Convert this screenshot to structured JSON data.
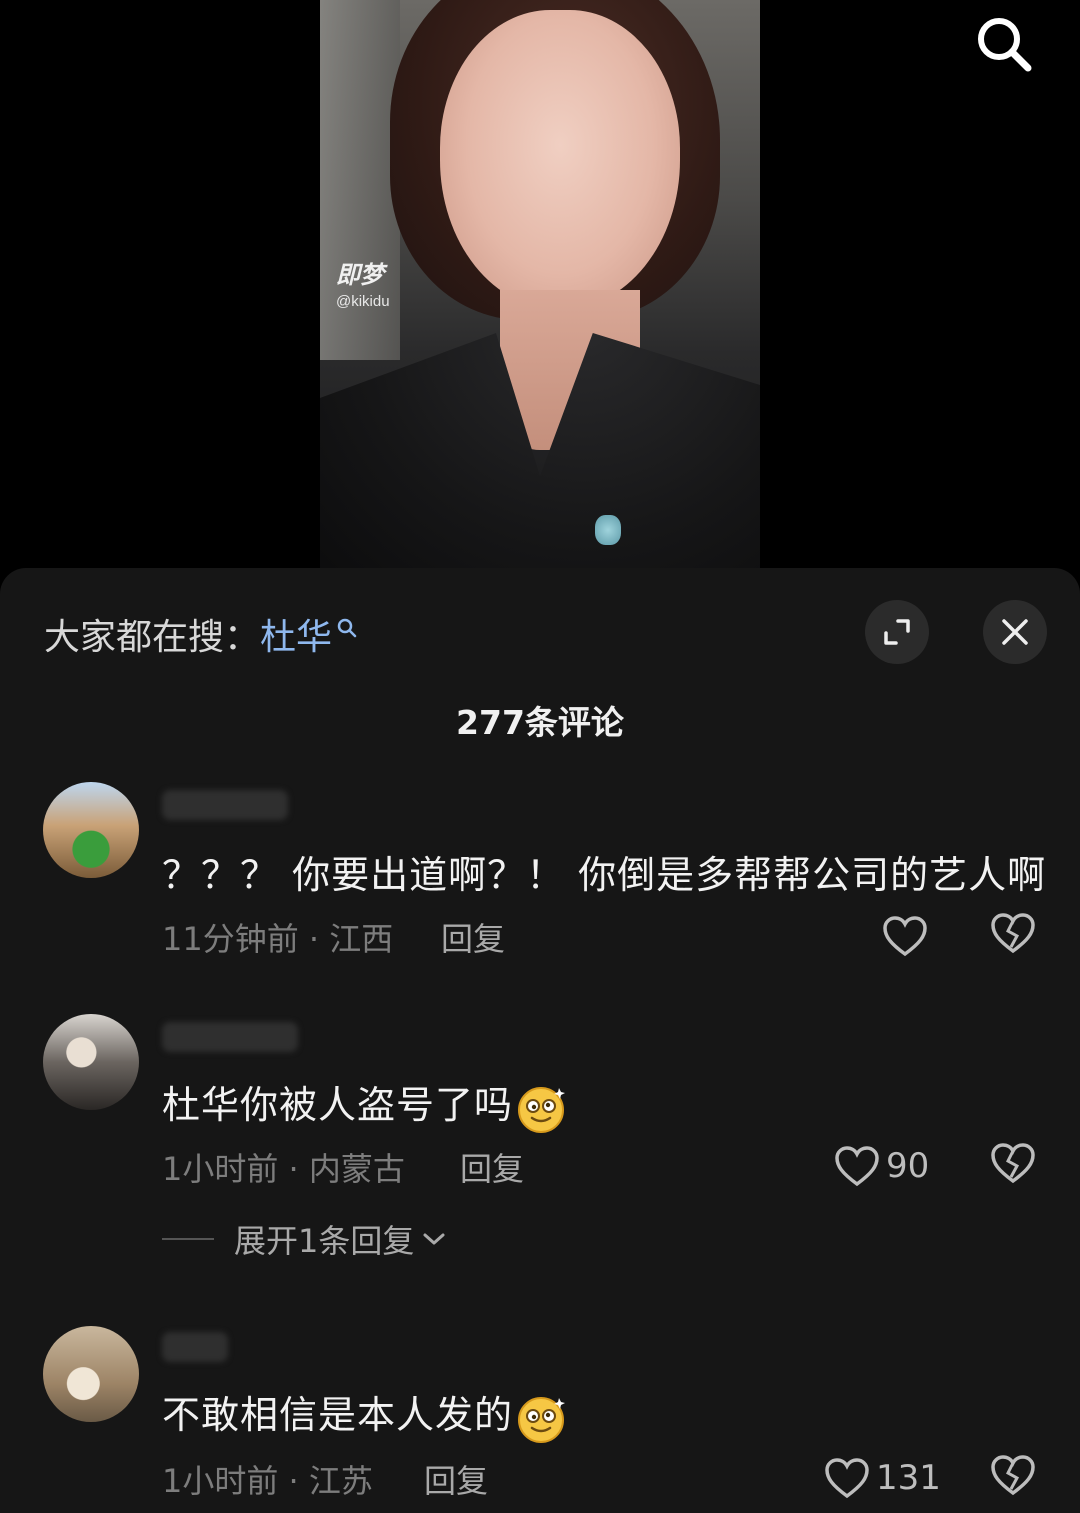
{
  "video": {
    "watermark_logo": "即梦",
    "watermark_handle": "@kikidu"
  },
  "search_icon": "search-icon",
  "sheet": {
    "search_prefix": "大家都在搜：",
    "search_keyword": "杜华",
    "expand_icon": "expand-icon",
    "close_icon": "close-icon",
    "comment_count": "277条评论"
  },
  "comments": [
    {
      "text": "？？？ 你要出道啊？！ 你倒是多帮帮公司的艺人啊",
      "meta": "11分钟前 · 江西",
      "reply_label": "回复",
      "likes": ""
    },
    {
      "text": "杜华你被人盗号了吗",
      "meta": "1小时前 · 内蒙古",
      "reply_label": "回复",
      "likes": "90",
      "expand_label": "展开1条回复"
    },
    {
      "text": "不敢相信是本人发的",
      "meta": "1小时前 · 江苏",
      "reply_label": "回复",
      "likes": "131"
    }
  ],
  "colors": {
    "background": "#000000",
    "sheet": "#161616",
    "keyword": "#8fb8ee",
    "meta": "#7d7d7d"
  }
}
